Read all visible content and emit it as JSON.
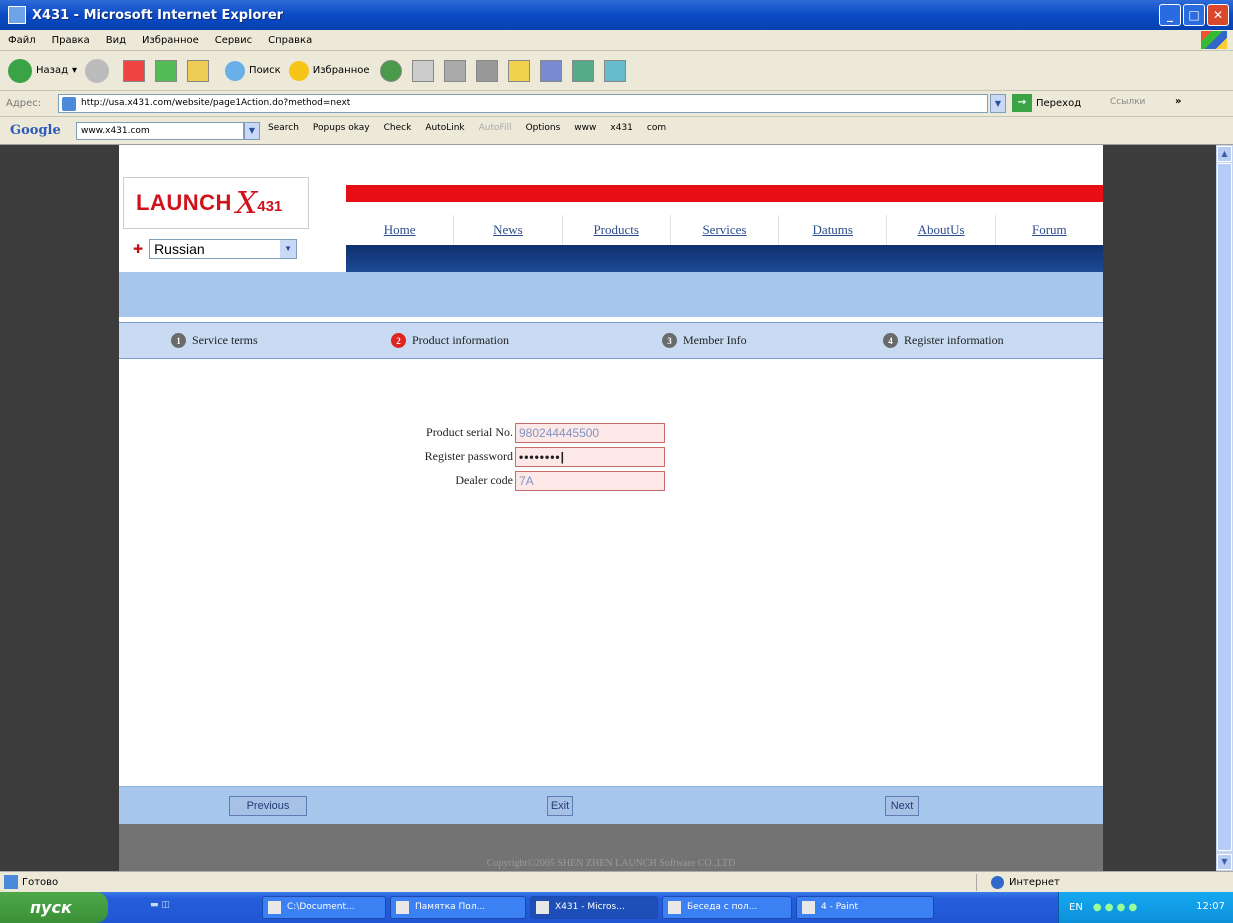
{
  "window": {
    "title": "X431 - Microsoft Internet Explorer"
  },
  "menu": [
    "Файл",
    "Правка",
    "Вид",
    "Избранное",
    "Сервис",
    "Справка"
  ],
  "toolbar": {
    "back": "Назад",
    "search": "Поиск",
    "favorites": "Избранное"
  },
  "address": {
    "label": "Адрес:",
    "url": "http://usa.x431.com/website/page1Action.do?method=next",
    "go": "Переход",
    "links": "Ссылки"
  },
  "google": {
    "logo": "Google",
    "field": "www.x431.com",
    "items": [
      "Search",
      "Popups okay",
      "Check",
      "AutoLink",
      "AutoFill",
      "Options",
      "www",
      "x431",
      "com"
    ]
  },
  "site": {
    "logo_text": "LAUNCH",
    "logo_x": "X",
    "logo_num": "431",
    "language": "Russian",
    "nav": [
      "Home",
      "News",
      "Products",
      "Services",
      "Datums",
      "AboutUs",
      "Forum"
    ]
  },
  "steps": [
    {
      "num": "1",
      "label": "Service terms"
    },
    {
      "num": "2",
      "label": "Product information"
    },
    {
      "num": "3",
      "label": "Member Info"
    },
    {
      "num": "4",
      "label": "Register information"
    }
  ],
  "form": {
    "serial_label": "Product serial No.",
    "serial_value": "980244445500",
    "password_label": "Register password",
    "password_value": "••••••••|",
    "dealer_label": "Dealer code",
    "dealer_value": "7A"
  },
  "buttons": {
    "previous": "Previous",
    "exit": "Exit",
    "next": "Next"
  },
  "footer": {
    "copyright": "Copyright©2005 SHEN ZHEN LAUNCH Software CO.,LTD"
  },
  "status": {
    "text": "Готово",
    "zone": "Интернет"
  },
  "taskbar": {
    "start": "пуск",
    "tasks": [
      "C:\\Document...",
      "Памятка Пол...",
      "X431 - Micros...",
      "Беседа с пол...",
      "4 - Paint"
    ],
    "lang": "EN",
    "clock": "12:07"
  }
}
